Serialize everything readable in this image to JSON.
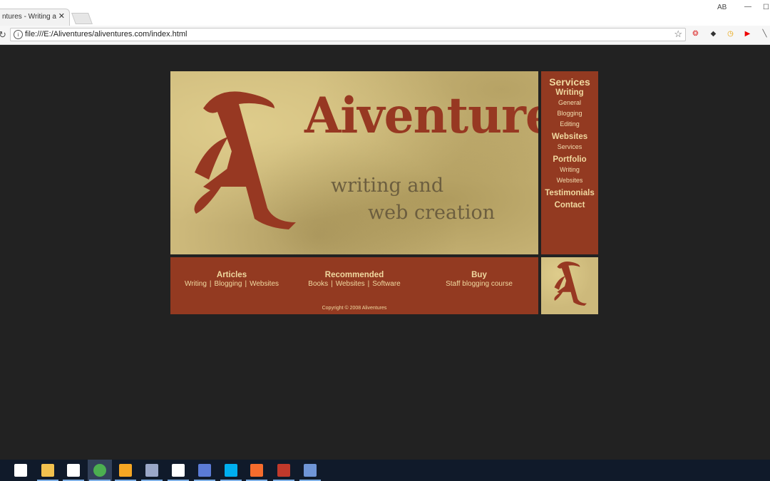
{
  "browser": {
    "tab_title": "ntures - Writing and",
    "tab_close": "✕",
    "url": "file:///E:/Aliventures/aliventures.com/index.html",
    "profile_label": "AB",
    "min_glyph": "—",
    "max_glyph": "☐",
    "reload_glyph": "↻",
    "info_glyph": "i",
    "star_glyph": "☆",
    "extensions": [
      {
        "name": "pdf-extension-icon",
        "glyph": "❂",
        "color": "#d33"
      },
      {
        "name": "evernote-extension-icon",
        "glyph": "◆",
        "color": "#333"
      },
      {
        "name": "clock-extension-icon",
        "glyph": "◷",
        "color": "#e8a000"
      },
      {
        "name": "youtube-extension-icon",
        "glyph": "▶",
        "color": "#e00"
      },
      {
        "name": "pen-extension-icon",
        "glyph": "╲",
        "color": "#555"
      }
    ]
  },
  "site": {
    "title": "Aiventures",
    "tagline_1": "writing and",
    "tagline_2": "web creation",
    "sidebar": {
      "heading": "Services",
      "sections": [
        {
          "label": "Writing",
          "items": [
            "General",
            "Blogging",
            "Editing"
          ]
        },
        {
          "label": "Websites",
          "items": [
            "Services"
          ]
        },
        {
          "label": "Portfolio",
          "items": [
            "Writing",
            "Websites"
          ]
        },
        {
          "label": "Testimonials",
          "items": []
        },
        {
          "label": "Contact",
          "items": []
        }
      ]
    },
    "footer": {
      "articles": {
        "heading": "Articles",
        "links": [
          "Writing",
          "Blogging",
          "Websites"
        ]
      },
      "recommended": {
        "heading": "Recommended",
        "links": [
          "Books",
          "Websites",
          "Software"
        ]
      },
      "buy": {
        "heading": "Buy",
        "links": [
          "Staff blogging course"
        ]
      },
      "separator": "|",
      "copyright": "Copyright © 2008 Aliventures"
    }
  },
  "colors": {
    "accent_rust": "#933a21",
    "text_cream": "#f0d9a0",
    "parchment": "#cdb97b",
    "page_bg": "#222222"
  },
  "taskbar": {
    "icons": [
      {
        "name": "task-view-icon",
        "color": "#ffffff"
      },
      {
        "name": "file-explorer-icon",
        "color": "#f2c14e"
      },
      {
        "name": "store-icon",
        "color": "#ffffff"
      },
      {
        "name": "chrome-icon",
        "color": "#4caf50"
      },
      {
        "name": "media-player-icon",
        "color": "#f5a623"
      },
      {
        "name": "monitor-app-icon",
        "color": "#9aa7c7"
      },
      {
        "name": "mail-icon",
        "color": "#ffffff"
      },
      {
        "name": "paint-icon",
        "color": "#5b7bd5"
      },
      {
        "name": "skype-icon",
        "color": "#00aff0"
      },
      {
        "name": "origin-icon",
        "color": "#f56c2d"
      },
      {
        "name": "game-icon",
        "color": "#c0392b"
      },
      {
        "name": "word-icon",
        "color": "#6f95d6"
      }
    ]
  }
}
